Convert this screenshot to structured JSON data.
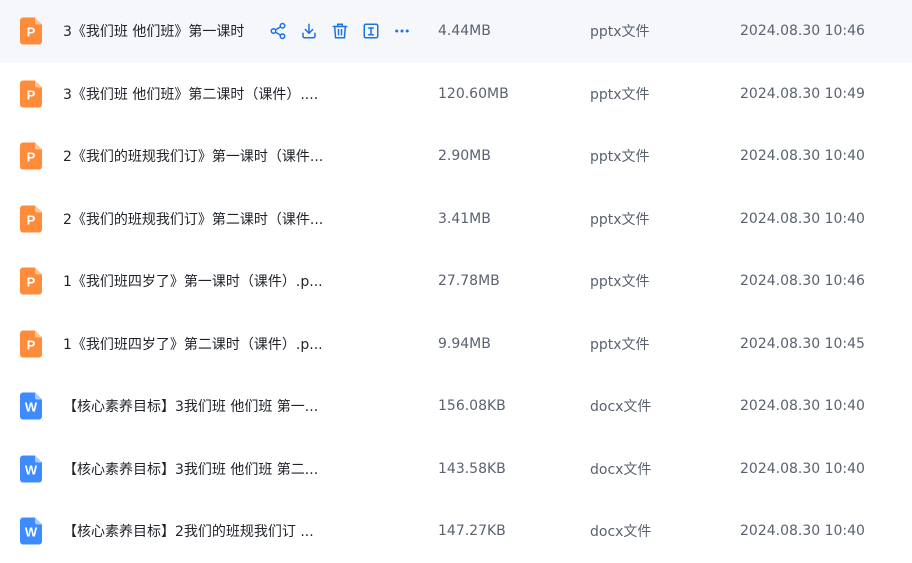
{
  "colors": {
    "ppt_icon": "#ff8c3b",
    "ppt_icon_fold": "#ffc493",
    "doc_icon": "#3d8bff",
    "doc_icon_fold": "#a9cbff",
    "action_icon": "#1a73e8",
    "hover_bg": "#f5f7fa"
  },
  "files": [
    {
      "icon": "ppt-file-icon",
      "letter": "P",
      "name": "3《我们班 他们班》第一课时",
      "size": "4.44MB",
      "type": "pptx文件",
      "date": "2024.08.30 10:46",
      "hovered": true
    },
    {
      "icon": "ppt-file-icon",
      "letter": "P",
      "name": "3《我们班 他们班》第二课时（课件）....",
      "size": "120.60MB",
      "type": "pptx文件",
      "date": "2024.08.30 10:49"
    },
    {
      "icon": "ppt-file-icon",
      "letter": "P",
      "name": "2《我们的班规我们订》第一课时（课件...",
      "size": "2.90MB",
      "type": "pptx文件",
      "date": "2024.08.30 10:40"
    },
    {
      "icon": "ppt-file-icon",
      "letter": "P",
      "name": "2《我们的班规我们订》第二课时（课件...",
      "size": "3.41MB",
      "type": "pptx文件",
      "date": "2024.08.30 10:40"
    },
    {
      "icon": "ppt-file-icon",
      "letter": "P",
      "name": "1《我们班四岁了》第一课时（课件）.p...",
      "size": "27.78MB",
      "type": "pptx文件",
      "date": "2024.08.30 10:46"
    },
    {
      "icon": "ppt-file-icon",
      "letter": "P",
      "name": "1《我们班四岁了》第二课时（课件）.p...",
      "size": "9.94MB",
      "type": "pptx文件",
      "date": "2024.08.30 10:45"
    },
    {
      "icon": "word-file-icon",
      "letter": "W",
      "name": "【核心素养目标】3我们班 他们班 第一...",
      "size": "156.08KB",
      "type": "docx文件",
      "date": "2024.08.30 10:40"
    },
    {
      "icon": "word-file-icon",
      "letter": "W",
      "name": "【核心素养目标】3我们班 他们班 第二...",
      "size": "143.58KB",
      "type": "docx文件",
      "date": "2024.08.30 10:40"
    },
    {
      "icon": "word-file-icon",
      "letter": "W",
      "name": "【核心素养目标】2我们的班规我们订 ...",
      "size": "147.27KB",
      "type": "docx文件",
      "date": "2024.08.30 10:40"
    }
  ],
  "hover_actions": [
    {
      "icon": "share-icon"
    },
    {
      "icon": "download-icon"
    },
    {
      "icon": "delete-icon"
    },
    {
      "icon": "rename-icon"
    },
    {
      "icon": "more-icon"
    }
  ]
}
